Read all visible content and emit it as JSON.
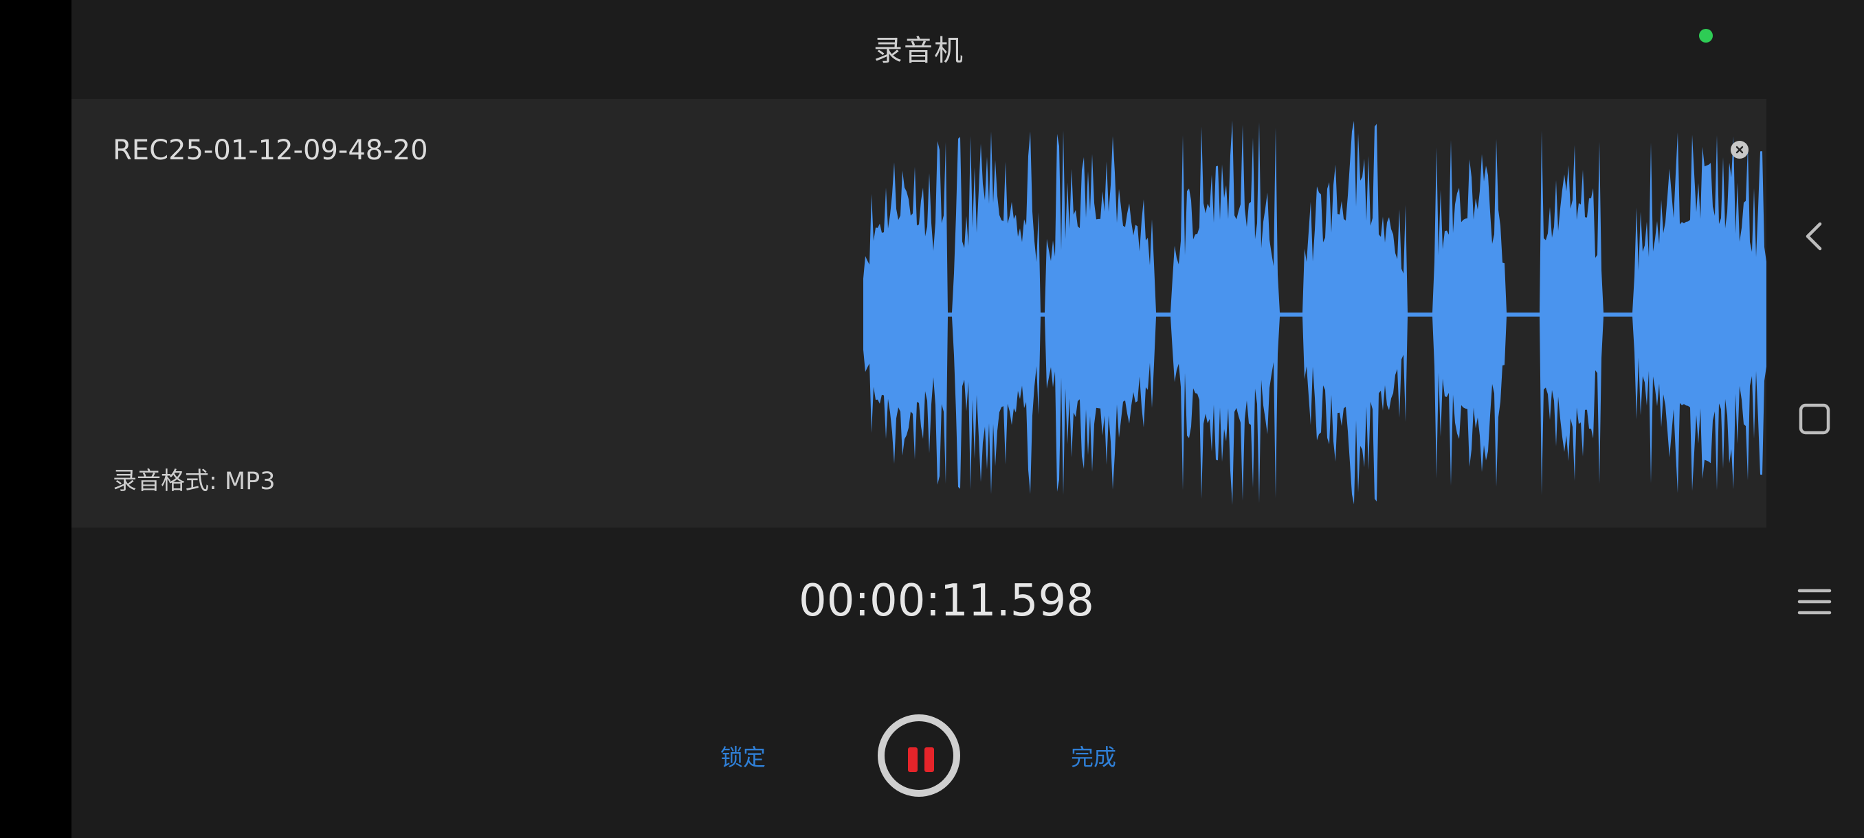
{
  "app": {
    "title": "录音机"
  },
  "recording": {
    "filename": "REC25-01-12-09-48-20",
    "format_label": "录音格式: MP3",
    "elapsed": "00:00:11.598"
  },
  "controls": {
    "lock_label": "锁定",
    "done_label": "完成"
  },
  "colors": {
    "waveform": "#4a94ee",
    "pause_icon": "#e5242a",
    "accent_text": "#2f7fd6",
    "status_dot": "#2ecc55"
  },
  "icons": {
    "close": "close-icon",
    "pause": "pause-icon",
    "back": "back-icon",
    "home": "home-icon",
    "menu": "menu-icon"
  }
}
